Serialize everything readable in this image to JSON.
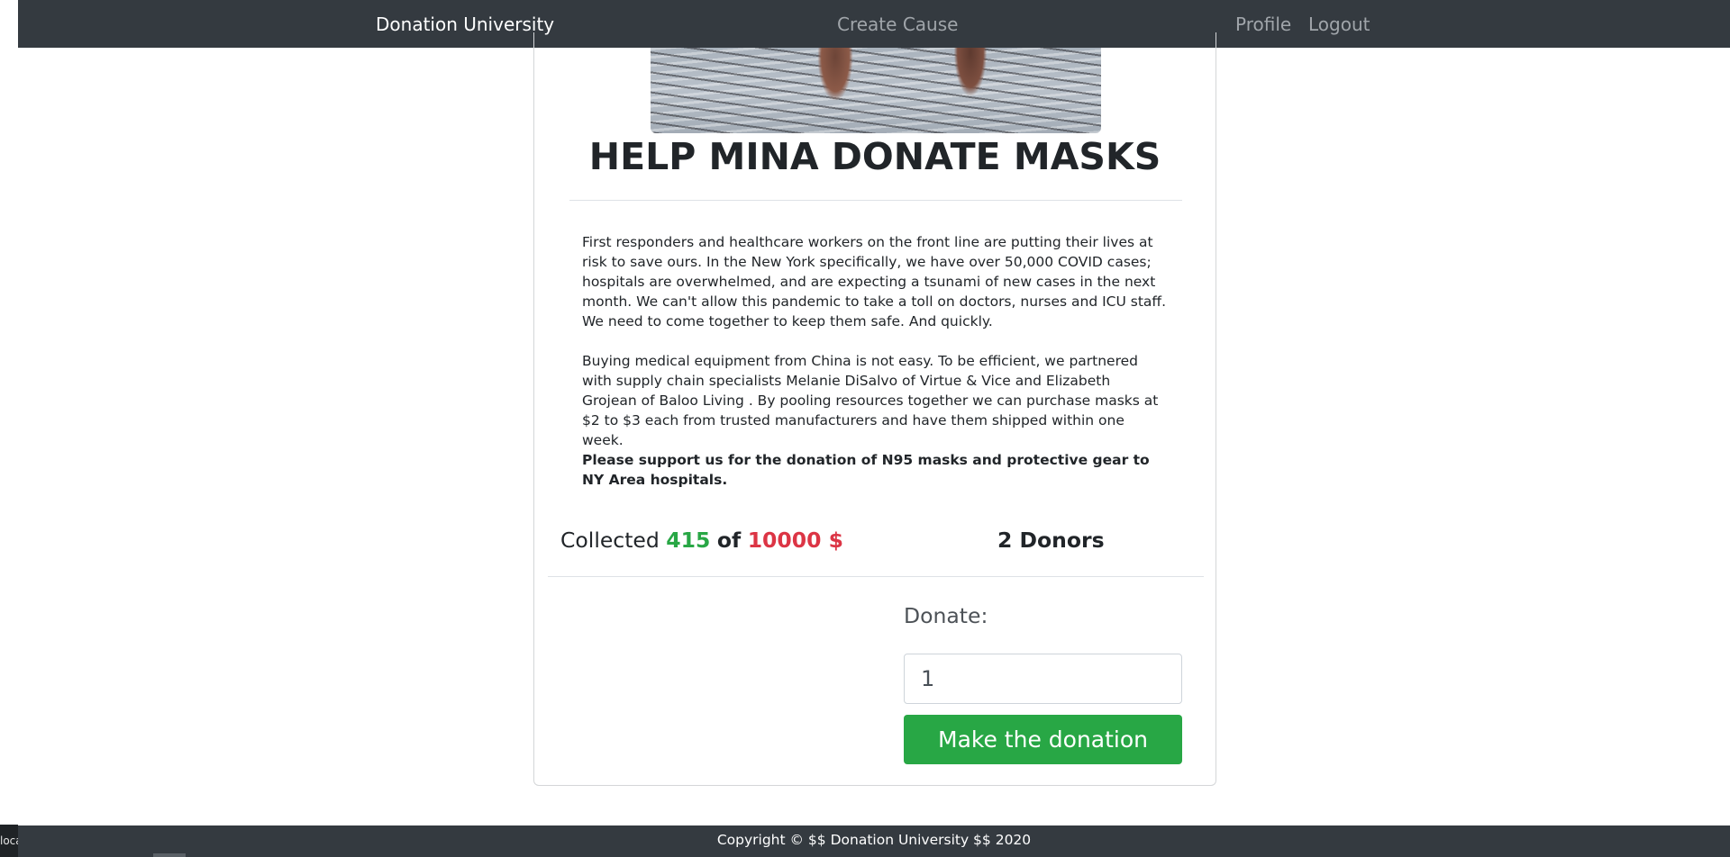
{
  "nav": {
    "brand": "Donation University",
    "create_cause": "Create Cause",
    "profile": "Profile",
    "logout": "Logout"
  },
  "cause": {
    "title": "HELP MINA DONATE MASKS",
    "paragraphs": [
      "First responders and healthcare workers on the front line are putting their lives at risk to save ours. In the New York specifically, we have over 50,000 COVID cases; hospitals are overwhelmed, and are expecting a tsunami of new cases in the next month. We can't allow this pandemic to take a toll on doctors, nurses and ICU staff. We need to come together to keep them safe. And quickly.",
      "Buying medical equipment from China is not easy. To be efficient, we partnered with supply chain specialists Melanie DiSalvo of Virtue & Vice and Elizabeth Grojean of Baloo Living . By pooling resources together we can purchase masks at $2 to $3 each from trusted manufacturers and have them shipped within one week."
    ],
    "appeal": "Please support us for the donation of N95 masks and protective gear to NY Area hospitals."
  },
  "stats": {
    "collected_label": "Collected",
    "collected_amount": "415",
    "of_label": "of",
    "goal_amount": "10000 $",
    "donors": "2 Donors"
  },
  "donate": {
    "label": "Donate:",
    "amount_value": "1",
    "button_label": "Make the donation"
  },
  "footer": {
    "copyright": "Copyright © $$ Donation University $$ 2020"
  },
  "status_bar": {
    "url_fragment": "loca"
  },
  "colors": {
    "navbar": "#343a40",
    "success": "#28a745",
    "danger": "#dc3545"
  }
}
